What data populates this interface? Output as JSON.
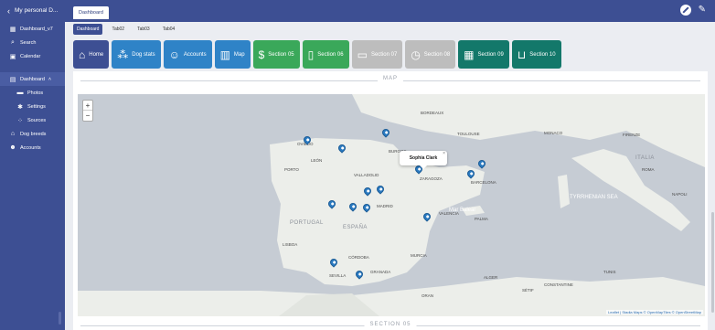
{
  "topbar": {
    "back_label": "My personal D...",
    "active_tab": "Dashboard"
  },
  "sidebar": {
    "items": [
      {
        "icon": "grid-icon",
        "label": "Dashboard_v7"
      },
      {
        "icon": "search-icon",
        "label": "Search"
      },
      {
        "icon": "calendar-icon",
        "label": "Calendar"
      },
      {
        "icon": "dashboard-icon",
        "label": "Dashboard"
      },
      {
        "icon": "photos-icon",
        "label": "Photos"
      },
      {
        "icon": "gear-icon",
        "label": "Settings"
      },
      {
        "icon": "sources-icon",
        "label": "Sources"
      },
      {
        "icon": "dog-icon",
        "label": "Dog breeds"
      },
      {
        "icon": "accounts-icon",
        "label": "Accounts"
      }
    ]
  },
  "subtabs": [
    "Dashboard",
    "Tab02",
    "Tab03",
    "Tab04"
  ],
  "sections": [
    {
      "label": "Home",
      "icon": "home-icon",
      "color": "#3d4f93"
    },
    {
      "label": "Dog stats",
      "icon": "paw-icon",
      "color": "#2f83c7"
    },
    {
      "label": "Accounts",
      "icon": "users-icon",
      "color": "#2f83c7"
    },
    {
      "label": "Map",
      "icon": "map-icon",
      "color": "#2f83c7"
    },
    {
      "label": "Section 05",
      "icon": "dollar-icon",
      "color": "#3aa85a"
    },
    {
      "label": "Section 06",
      "icon": "barcode-icon",
      "color": "#3aa85a"
    },
    {
      "label": "Section 07",
      "icon": "chat-icon",
      "color": "#bdbdbd"
    },
    {
      "label": "Section 08",
      "icon": "clock-icon",
      "color": "#bdbdbd"
    },
    {
      "label": "Section 09",
      "icon": "calendar-icon",
      "color": "#13786a"
    },
    {
      "label": "Section 10",
      "icon": "cart-icon",
      "color": "#13786a"
    }
  ],
  "map_section": {
    "title": "MAP",
    "zoom_in": "+",
    "zoom_out": "−",
    "popup_name": "Sophia Clark",
    "popup_close": "×",
    "attribution": "Leaflet | Stadia Maps © OpenMapTiles © OpenStreetMap",
    "labels": {
      "portugal": "PORTUGAL",
      "espana": "ESPAÑA",
      "lisboa": "LISBOA",
      "madrid": "MADRID",
      "valladolid": "VALLADOLID",
      "zaragoza": "ZARAGOZA",
      "barcelona": "BARCELONA",
      "bordeaux": "BORDEAUX",
      "toulouse": "TOULOUSE",
      "monaco": "MONACO",
      "firenze": "FIRENZE",
      "italia": "ITALIA",
      "roma": "ROMA",
      "napoli": "NAPOLI",
      "sevilla": "SEVILLA",
      "granada": "GRANADA",
      "cordoba": "CÓRDOBA",
      "murcia": "MURCIA",
      "valencia": "VALENCIA",
      "palma": "PALMA",
      "oran": "ORAN",
      "alger": "ALGER",
      "tunis": "TUNIS",
      "setif": "SÉTIF",
      "constantine": "CONSTANTINE",
      "tyrrhenian": "TYRRHENIAN SEA",
      "mar_balear": "Mar Balear",
      "oviedo": "OVIEDO",
      "leon": "LEÓN",
      "burgos": "BURGOS",
      "porto": "PORTO"
    }
  },
  "next_section": {
    "title": "SECTION 05"
  },
  "colors": {
    "brand": "#3d4f93",
    "sky_blue": "#2f83c7",
    "green": "#3aa85a",
    "grey": "#bdbdbd",
    "teal": "#13786a",
    "pin": "#2b7bc2"
  }
}
